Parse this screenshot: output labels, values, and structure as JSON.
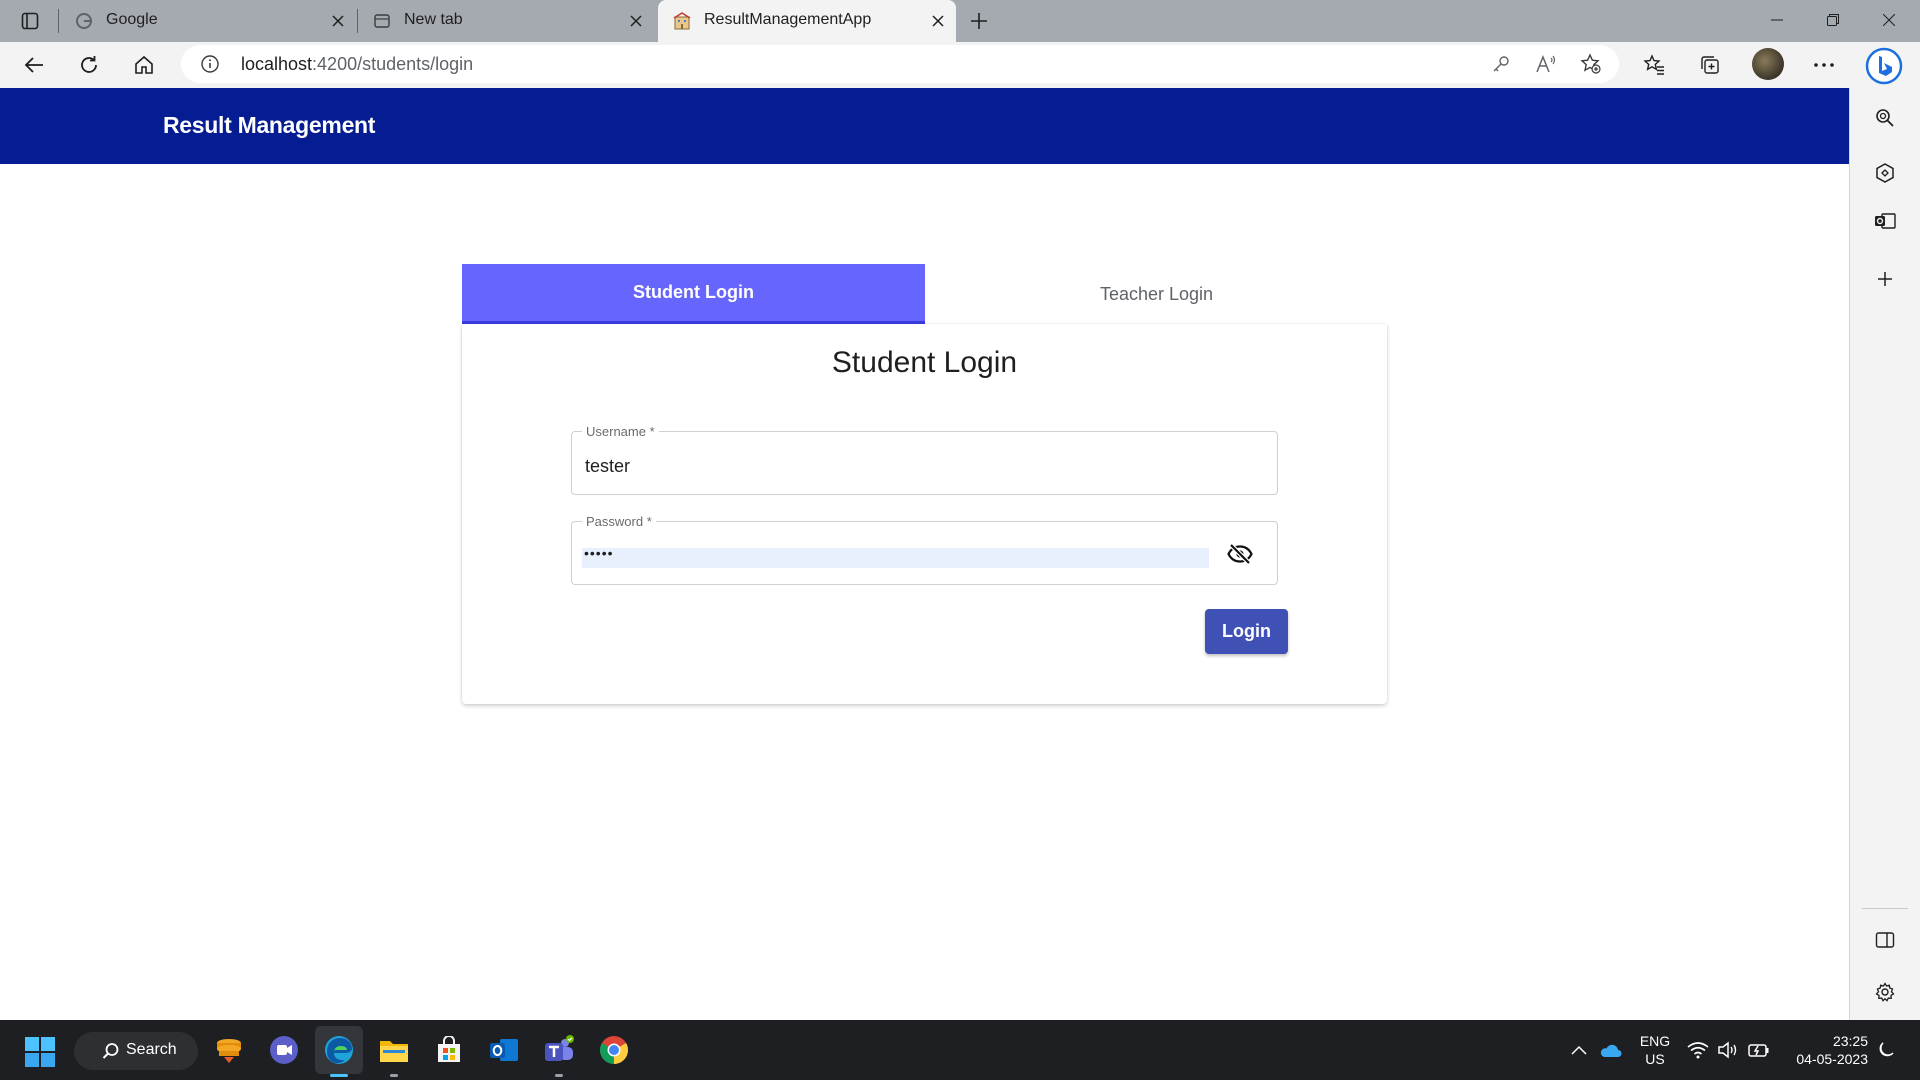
{
  "browser": {
    "tabs": [
      {
        "title": "Google",
        "favicon": "google-g-icon",
        "active": false
      },
      {
        "title": "New tab",
        "favicon": "new-tab-page-icon",
        "active": false
      },
      {
        "title": "ResultManagementApp",
        "favicon": "app-building-icon",
        "active": true
      }
    ],
    "address": {
      "host": "localhost",
      "path": ":4200/students/login"
    },
    "toolbar_icons": [
      "back-icon",
      "refresh-icon",
      "home-icon",
      "site-info-icon",
      "password-key-icon",
      "read-aloud-icon",
      "add-favorite-icon",
      "favorites-icon",
      "collections-icon",
      "profile-avatar",
      "more-icon",
      "bing-copilot-icon"
    ],
    "sidebar_icons": [
      "search-sidebar-icon",
      "tools-sidebar-icon",
      "outlook-sidebar-icon",
      "add-sidebar-icon",
      "split-screen-icon",
      "settings-icon"
    ]
  },
  "app": {
    "title": "Result Management",
    "colors": {
      "header": "#061c92",
      "active_tab": "#6666ff",
      "button": "#3f51b5"
    }
  },
  "login": {
    "tabs": [
      {
        "label": "Student Login",
        "active": true
      },
      {
        "label": "Teacher Login",
        "active": false
      }
    ],
    "heading": "Student Login",
    "username": {
      "label": "Username *",
      "value": "tester"
    },
    "password": {
      "label": "Password *",
      "masked_value": "•••••"
    },
    "submit_label": "Login"
  },
  "taskbar": {
    "search_label": "Search",
    "apps": [
      "stacked-coins-app-icon",
      "meet-now-video-icon",
      "edge-browser-icon",
      "file-explorer-icon",
      "microsoft-store-icon",
      "outlook-icon",
      "teams-icon",
      "chrome-icon"
    ],
    "language": {
      "line1": "ENG",
      "line2": "US"
    },
    "time": "23:25",
    "date": "04-05-2023"
  }
}
